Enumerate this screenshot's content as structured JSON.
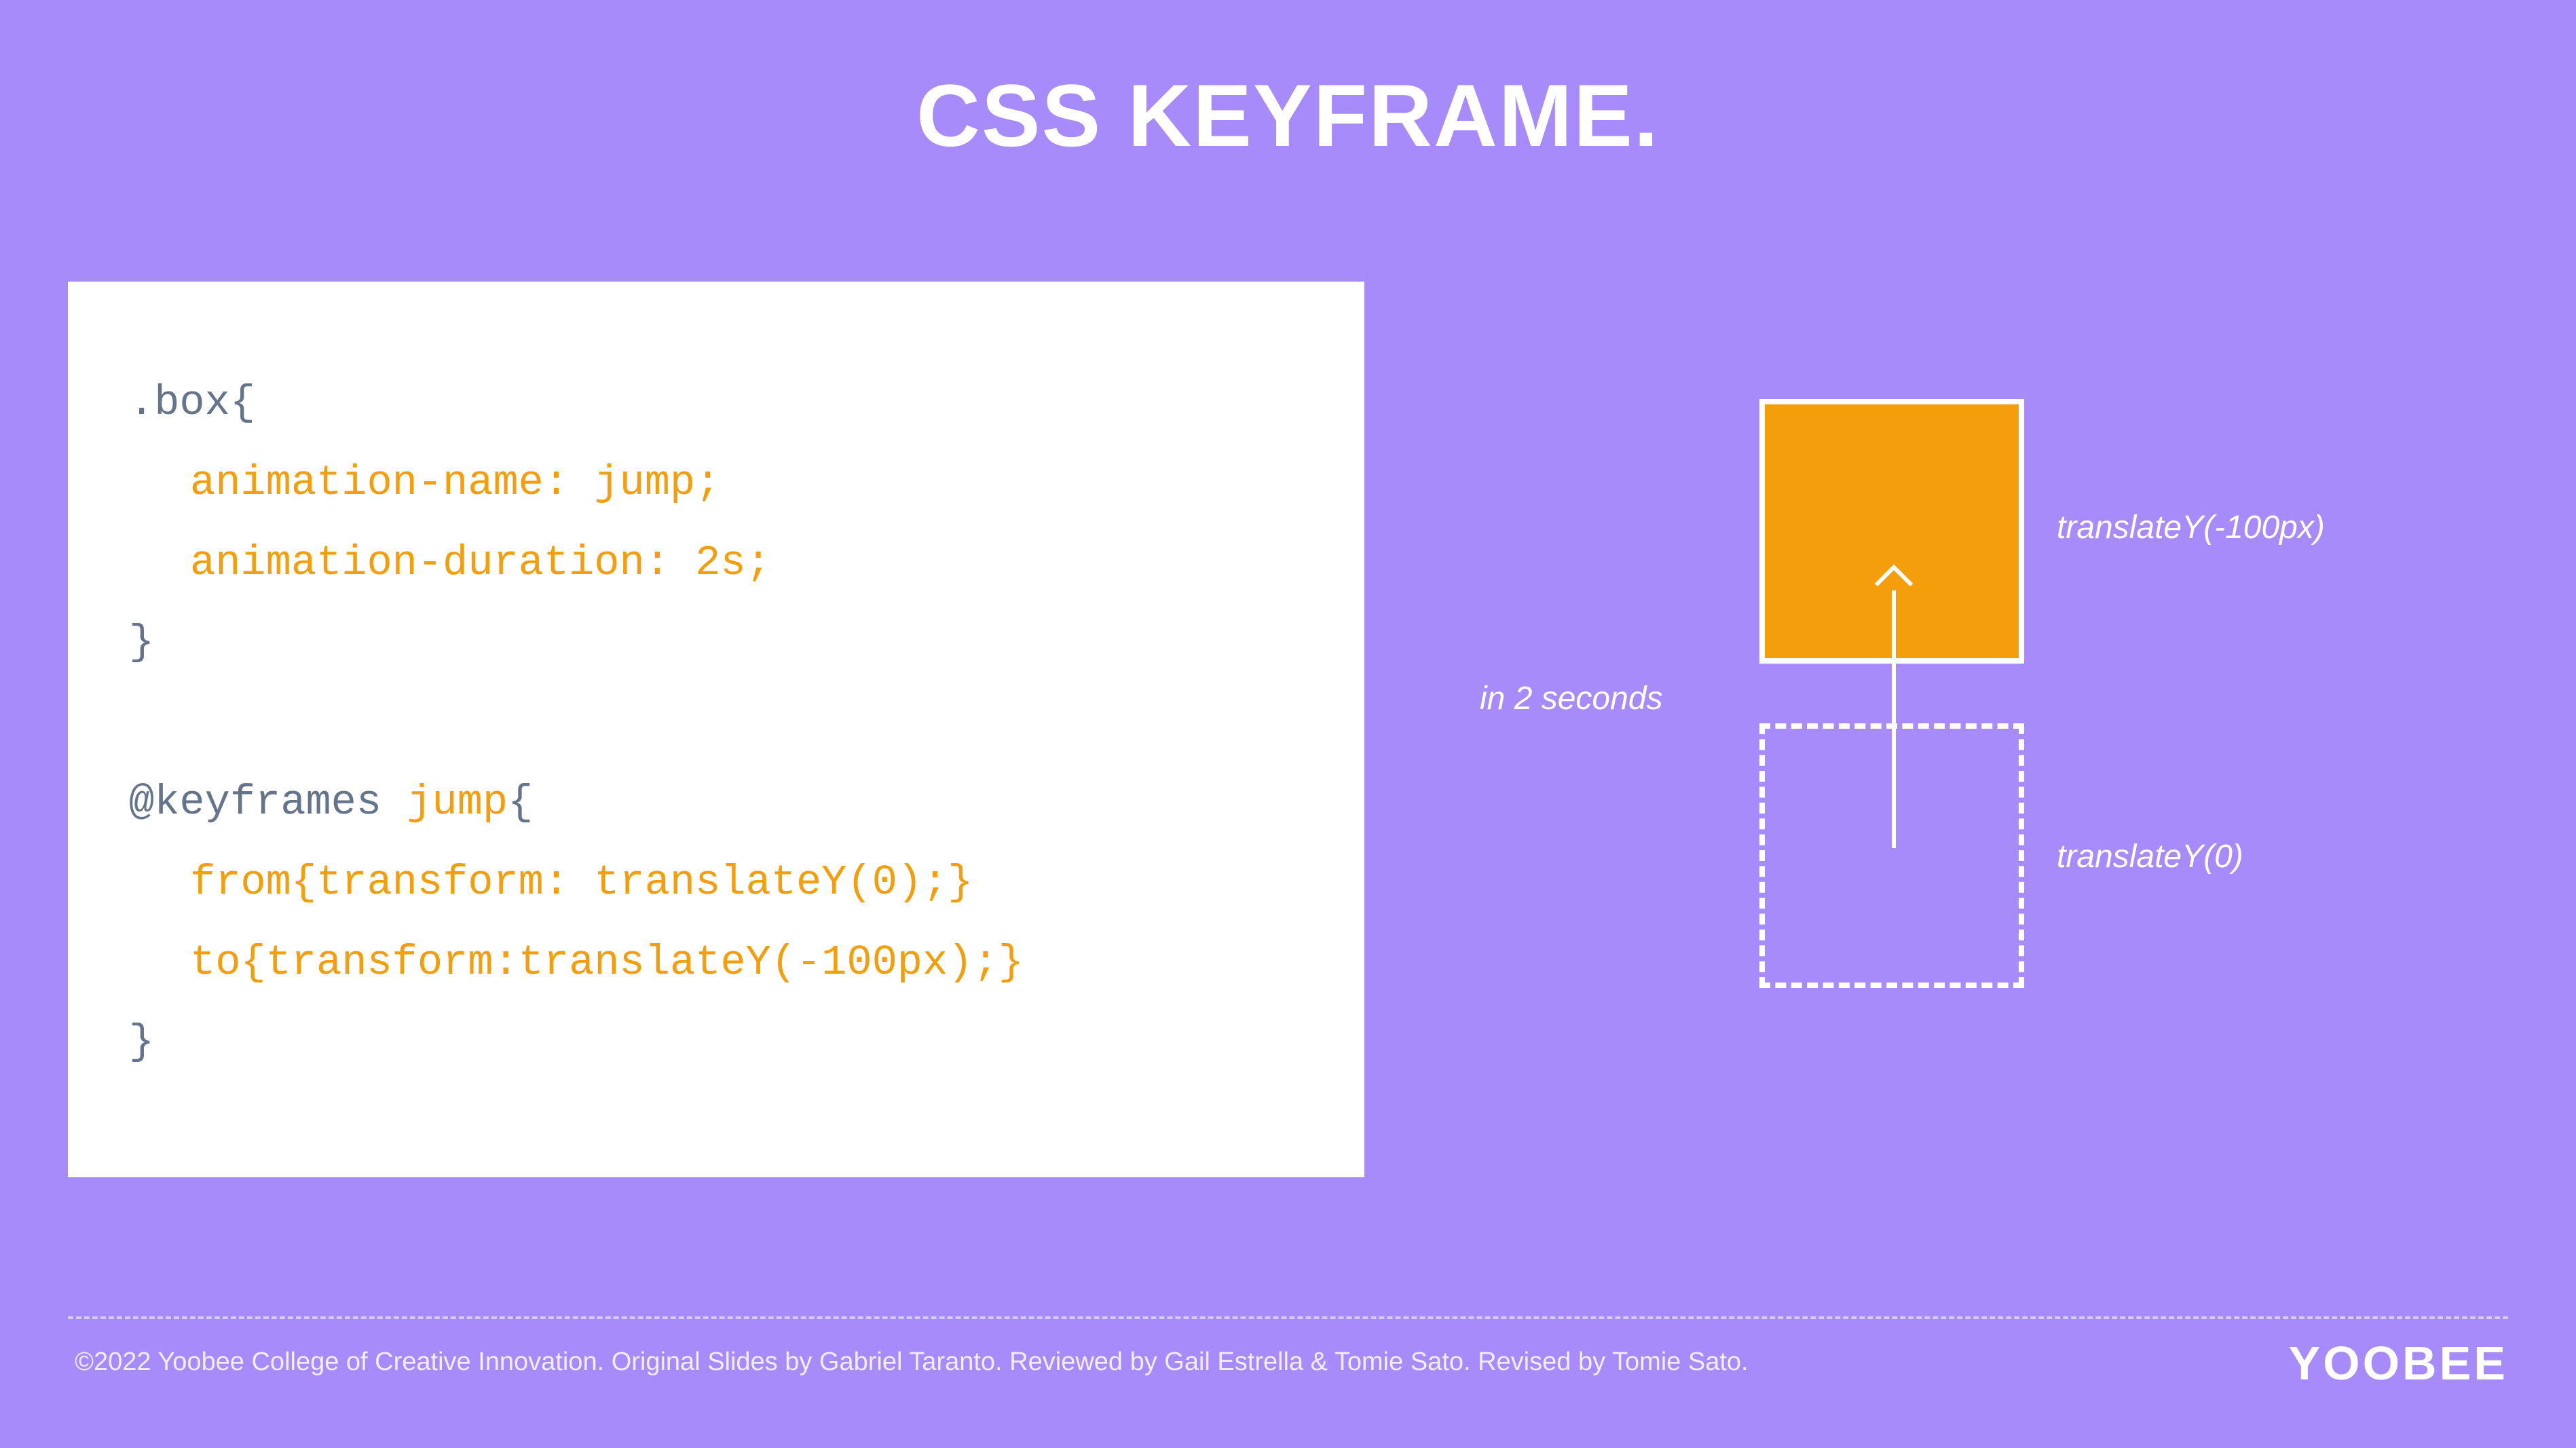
{
  "title": "CSS KEYFRAME.",
  "code": {
    "line1": ".box{",
    "line2": "animation-name: jump;",
    "line3": "animation-duration: 2s;",
    "line4": "}",
    "line5_a": "@keyframes ",
    "line5_b": "jump",
    "line5_c": "{",
    "line6": "from{transform: translateY(0);}",
    "line7": "to{transform:translateY(-100px);}",
    "line8": "}"
  },
  "diagram": {
    "label_top": "translateY(-100px)",
    "label_bottom": "translateY(0)",
    "label_duration": "in 2 seconds"
  },
  "footer": {
    "text": "©2022 Yoobee College of Creative Innovation.  Original Slides by Gabriel Taranto.  Reviewed by Gail Estrella & Tomie Sato.  Revised by Tomie Sato.",
    "logo": "YOOBEE"
  }
}
